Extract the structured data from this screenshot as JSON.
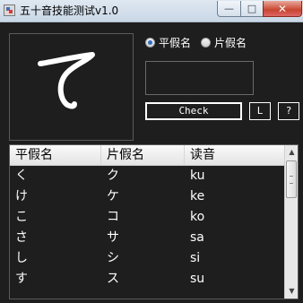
{
  "window": {
    "title": "五十音技能测试v1.0",
    "buttons": {
      "minimize": "—",
      "maximize": "□",
      "close": "✕"
    }
  },
  "kana_mode": {
    "hiragana_label": "平假名",
    "katakana_label": "片假名",
    "selected": "hiragana"
  },
  "drawing": {
    "character": "て"
  },
  "answer_field": {
    "value": ""
  },
  "buttons": {
    "check": "Check",
    "l": "L",
    "help": "?"
  },
  "table": {
    "columns": [
      "平假名",
      "片假名",
      "读音"
    ],
    "rows": [
      [
        "く",
        "ク",
        "ku"
      ],
      [
        "け",
        "ケ",
        "ke"
      ],
      [
        "こ",
        "コ",
        "ko"
      ],
      [
        "さ",
        "サ",
        "sa"
      ],
      [
        "し",
        "シ",
        "si"
      ],
      [
        "す",
        "ス",
        "su"
      ]
    ]
  },
  "icons": {
    "app": "app-icon",
    "scroll_up": "scroll-up-icon",
    "scroll_down": "scroll-down-icon"
  }
}
